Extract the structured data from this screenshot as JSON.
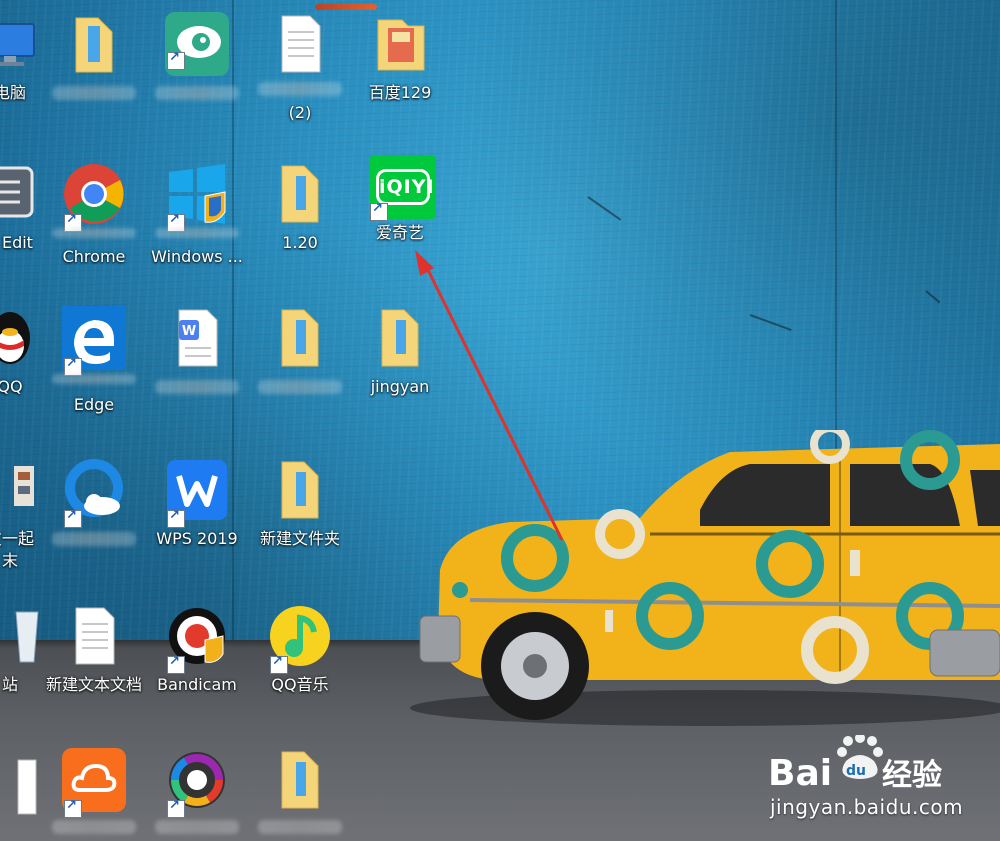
{
  "desktop": {
    "icons": [
      {
        "id": "pc",
        "label": "电脑",
        "visible": true
      },
      {
        "id": "folder-1",
        "label": "",
        "visible": false
      },
      {
        "id": "eye-app",
        "label": "",
        "visible": false
      },
      {
        "id": "doc-1",
        "label": "(2)",
        "visible": true
      },
      {
        "id": "folder-129",
        "label": "百度129",
        "visible": true
      },
      {
        "id": "editor",
        "label": "e Edit",
        "visible": true
      },
      {
        "id": "chrome",
        "label": "Chrome",
        "visible": true
      },
      {
        "id": "windows-app",
        "label": "Windows ...",
        "visible": true
      },
      {
        "id": "folder-120",
        "label": "1.20",
        "visible": true
      },
      {
        "id": "iqiyi",
        "label": "爱奇艺",
        "visible": true
      },
      {
        "id": "qq",
        "label": "QQ",
        "visible": true
      },
      {
        "id": "edge",
        "label": "Edge",
        "visible": true
      },
      {
        "id": "wps-doc",
        "label": "",
        "visible": false
      },
      {
        "id": "folder-2",
        "label": "",
        "visible": false
      },
      {
        "id": "folder-jingyan",
        "label": "jingyan",
        "visible": true
      },
      {
        "id": "partial-1",
        "label": "友一起",
        "visible": true
      },
      {
        "id": "partial-1b",
        "label": "末",
        "visible": true
      },
      {
        "id": "qq-browser",
        "label": "",
        "visible": false
      },
      {
        "id": "wps",
        "label": "WPS 2019",
        "visible": true
      },
      {
        "id": "new-folder",
        "label": "新建文件夹",
        "visible": true
      },
      {
        "id": "recycle",
        "label": "站",
        "visible": true
      },
      {
        "id": "new-text",
        "label": "新建文本文档",
        "visible": true
      },
      {
        "id": "bandicam",
        "label": "Bandicam",
        "visible": true
      },
      {
        "id": "qq-music",
        "label": "QQ音乐",
        "visible": true
      },
      {
        "id": "doc-bottom",
        "label": "",
        "visible": false
      },
      {
        "id": "cloud",
        "label": "",
        "visible": false
      },
      {
        "id": "color-app",
        "label": "",
        "visible": false
      },
      {
        "id": "folder-bottom",
        "label": "",
        "visible": false
      }
    ],
    "iqiyi_logo": "iQIYI"
  },
  "watermark": {
    "brand": "Bai",
    "brand2": "du",
    "cn": "经验",
    "url": "jingyan.baidu.com"
  },
  "colors": {
    "wall": "#2a8fc0",
    "iqiyi_green": "#00c93b",
    "arrow": "#e0322d",
    "car_yellow": "#f2b21a",
    "car_teal": "#2a9a93"
  }
}
